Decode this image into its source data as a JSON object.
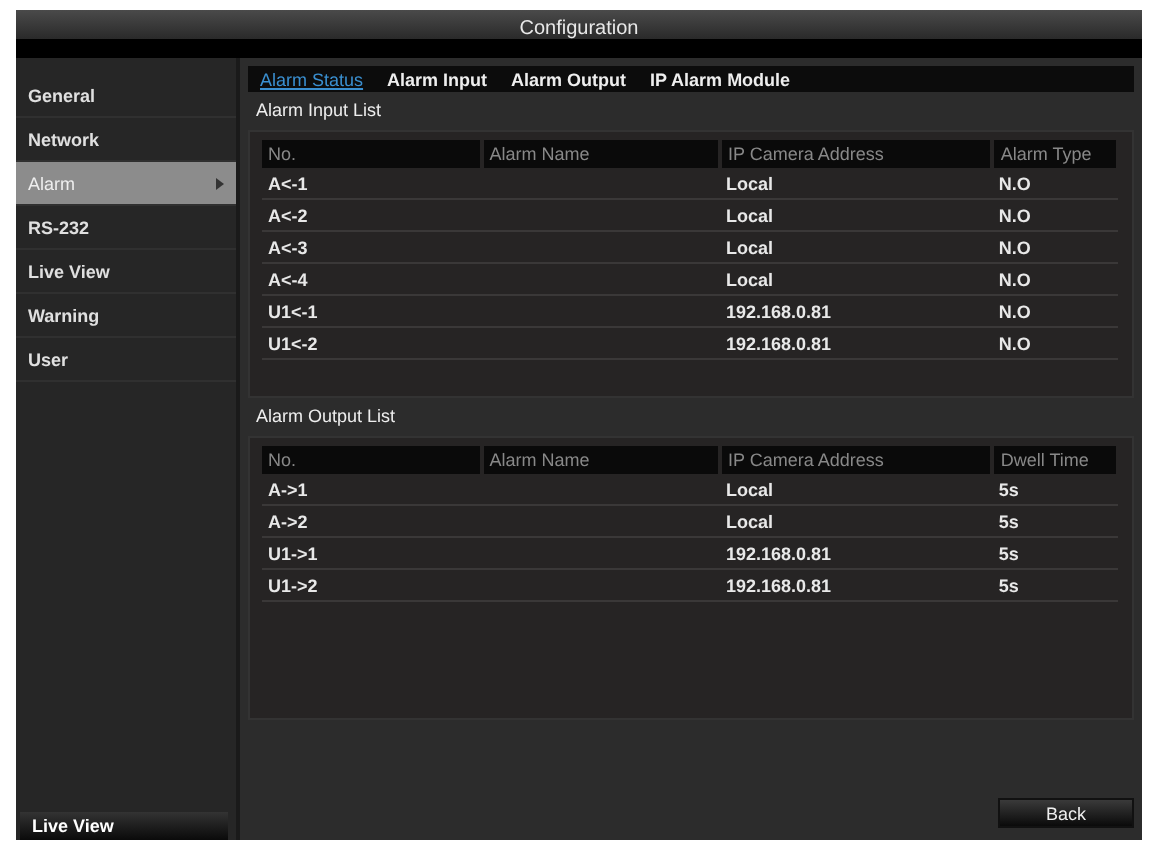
{
  "window": {
    "title": "Configuration"
  },
  "sidebar": {
    "items": [
      {
        "label": "General",
        "selected": false
      },
      {
        "label": "Network",
        "selected": false
      },
      {
        "label": "Alarm",
        "selected": true
      },
      {
        "label": "RS-232",
        "selected": false
      },
      {
        "label": "Live View",
        "selected": false
      },
      {
        "label": "Warning",
        "selected": false
      },
      {
        "label": "User",
        "selected": false
      }
    ],
    "bottom_button": "Live View"
  },
  "tabs": [
    {
      "label": "Alarm Status",
      "selected": true
    },
    {
      "label": "Alarm Input",
      "selected": false
    },
    {
      "label": "Alarm Output",
      "selected": false
    },
    {
      "label": "IP Alarm Module",
      "selected": false
    }
  ],
  "input_list": {
    "title": "Alarm Input List",
    "columns": [
      "No.",
      "Alarm Name",
      "IP Camera Address",
      "Alarm Type"
    ],
    "rows": [
      [
        "A<-1",
        "",
        "Local",
        "N.O"
      ],
      [
        "A<-2",
        "",
        "Local",
        "N.O"
      ],
      [
        "A<-3",
        "",
        "Local",
        "N.O"
      ],
      [
        "A<-4",
        "",
        "Local",
        "N.O"
      ],
      [
        "U1<-1",
        "",
        "192.168.0.81",
        "N.O"
      ],
      [
        "U1<-2",
        "",
        "192.168.0.81",
        "N.O"
      ]
    ]
  },
  "output_list": {
    "title": "Alarm Output List",
    "columns": [
      "No.",
      "Alarm Name",
      "IP Camera Address",
      "Dwell Time"
    ],
    "rows": [
      [
        "A->1",
        "",
        "Local",
        "5s"
      ],
      [
        "A->2",
        "",
        "Local",
        "5s"
      ],
      [
        "U1->1",
        "",
        "192.168.0.81",
        "5s"
      ],
      [
        "U1->2",
        "",
        "192.168.0.81",
        "5s"
      ]
    ]
  },
  "buttons": [
    "Back"
  ]
}
